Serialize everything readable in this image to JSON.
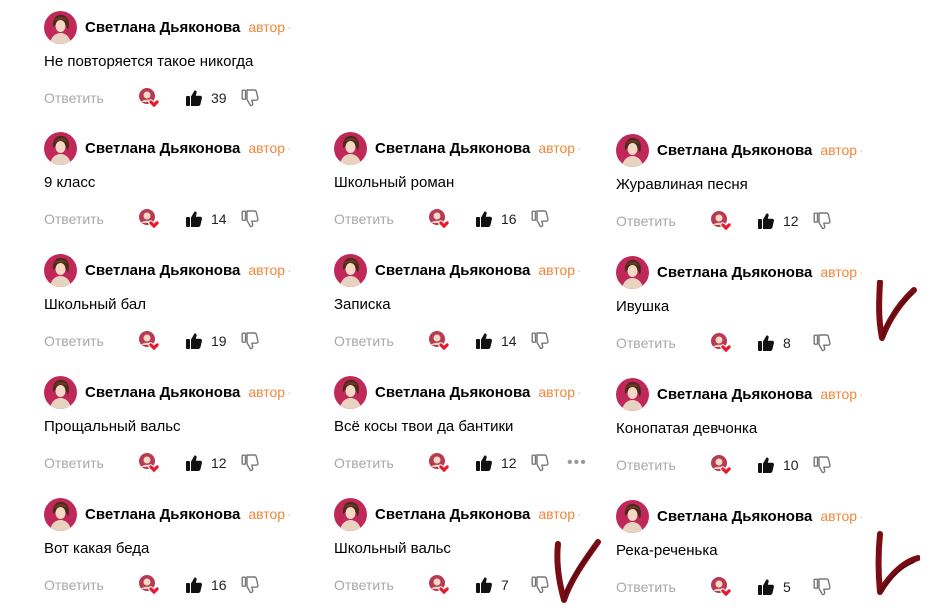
{
  "author_label": "автор",
  "reply_label": "Ответить",
  "user_name": "Светлана Дьяконова",
  "comments": [
    {
      "text": "Не повторяется такое никогда",
      "likes": "39"
    },
    {
      "text": "9 класс",
      "likes": "14"
    },
    {
      "text": "Школьный роман",
      "likes": "16"
    },
    {
      "text": "Журавлиная песня",
      "likes": "12"
    },
    {
      "text": "Школьный бал",
      "likes": "19"
    },
    {
      "text": "Записка",
      "likes": "14"
    },
    {
      "text": "Ивушка",
      "likes": "8"
    },
    {
      "text": "Прощальный вальс",
      "likes": "12"
    },
    {
      "text": "Всё косы твои да бантики",
      "likes": "12"
    },
    {
      "text": "Конопатая девчонка",
      "likes": "10"
    },
    {
      "text": "Вот какая беда",
      "likes": "16"
    },
    {
      "text": "Школьный вальс",
      "likes": "7"
    },
    {
      "text": "Река-реченька",
      "likes": "5"
    }
  ],
  "colors": {
    "accent": "#f0873b",
    "checkmark": "#7a0d14",
    "avatar_bg": "#c0285a"
  },
  "icons": {
    "like": "thumbs-up-icon",
    "dislike": "thumbs-down-icon",
    "liked_by_author": "author-heart-icon",
    "more": "more-dots-icon"
  }
}
